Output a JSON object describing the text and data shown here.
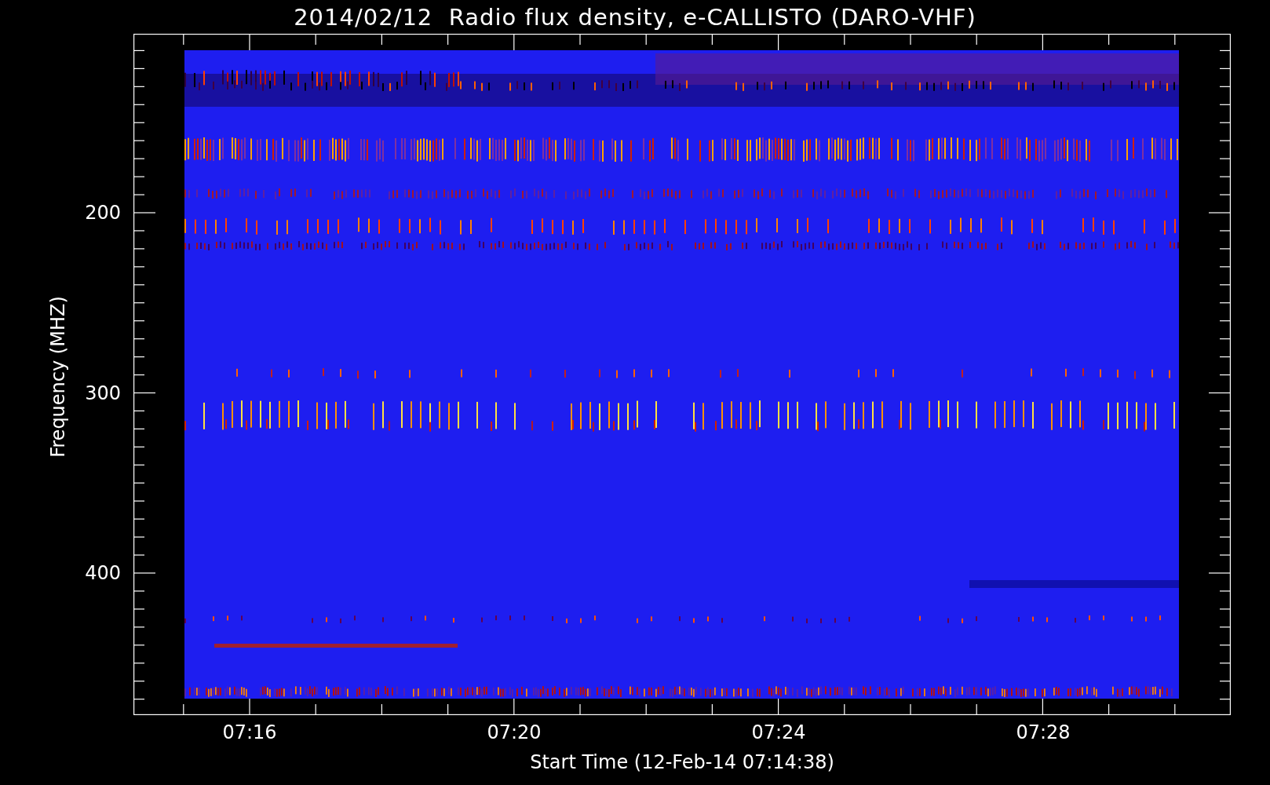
{
  "title": "2014/02/12  Radio flux density, e-CALLISTO (DARO-VHF)",
  "y_axis": {
    "label": "Frequency (MHZ)",
    "ticks": [
      "200",
      "300",
      "400"
    ]
  },
  "x_axis": {
    "label": "Start Time (12-Feb-14 07:14:38)",
    "ticks": [
      "07:16",
      "07:20",
      "07:24",
      "07:28"
    ]
  }
}
